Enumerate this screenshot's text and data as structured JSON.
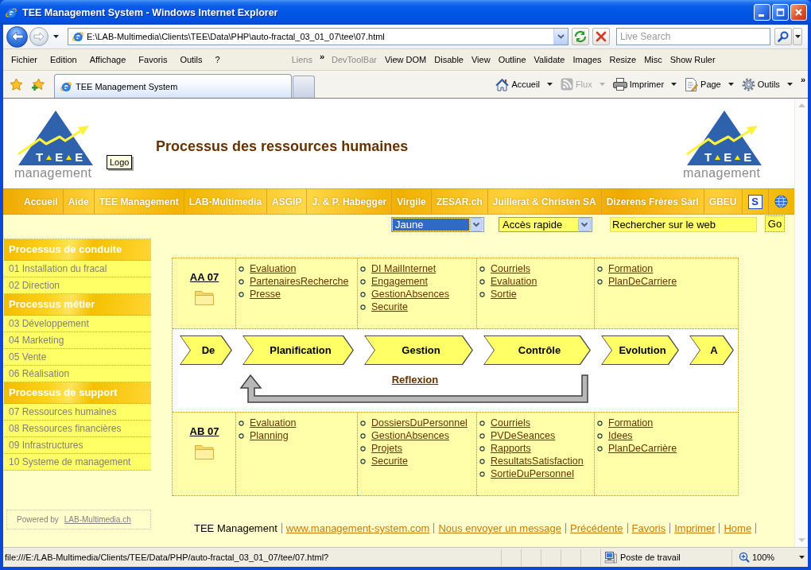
{
  "window": {
    "title": "TEE Management System - Windows Internet Explorer"
  },
  "address_bar": {
    "url": "E:\\LAB-Multimedia\\Clients\\TEE\\Data\\PHP\\auto-fractal_03_01_07\\tee\\07.html",
    "search": {
      "placeholder": "Live Search"
    }
  },
  "menu_bar": {
    "items": [
      "Fichier",
      "Edition",
      "Affichage",
      "Favoris",
      "Outils",
      "?"
    ]
  },
  "links_bar": {
    "label": "Liens",
    "more": "»"
  },
  "dev_toolbar": {
    "label": "DevToolBar",
    "items": [
      "View DOM",
      "Disable",
      "View",
      "Outline",
      "Validate",
      "Images",
      "Resize",
      "Misc",
      "Show Ruler"
    ]
  },
  "tabs": [
    {
      "label": "TEE Management System",
      "selected": true
    }
  ],
  "command_bar": {
    "items": [
      {
        "kind": "home",
        "label": "Accueil",
        "disabled": false
      },
      {
        "kind": "feeds",
        "label": "Flux",
        "disabled": true
      },
      {
        "kind": "print",
        "label": "Imprimer",
        "disabled": false
      },
      {
        "kind": "page",
        "label": "Page",
        "disabled": false
      },
      {
        "kind": "tools",
        "label": "Outils",
        "disabled": false
      }
    ],
    "more": "»"
  },
  "page": {
    "header": {
      "logos": [
        {
          "letters": [
            "T",
            "E",
            "E"
          ],
          "wordmark": "management"
        },
        {
          "letters": [
            "T",
            "E",
            "E"
          ],
          "wordmark": "management"
        }
      ],
      "title": "Processus des ressources humaines",
      "tooltip": "Logo"
    },
    "nav": {
      "links": [
        "Accueil",
        "Aide",
        "TEE Management",
        "LAB-Multimedia",
        "ASGIP",
        "J. & P. Habegger",
        "Virgile",
        "ZESAR.ch",
        "Juillerat & Christen SA",
        "Dizerens Frères Sàrl",
        "GBEU"
      ],
      "badge": "S"
    },
    "tools": {
      "color_select": {
        "value": "Jaune",
        "focused": true
      },
      "quick_select": {
        "value": "Accès rapide",
        "focused": false
      },
      "web_search": {
        "value": "Rechercher sur le web"
      },
      "go_button": "Go"
    },
    "sidebar": {
      "sections": [
        {
          "title": "Processus de conduite",
          "items": [
            "01 Installation du fracal",
            "02 Direction"
          ]
        },
        {
          "title": "Processus métier",
          "items": [
            "03 Développement",
            "04 Marketing",
            "05 Vente",
            "06 Réalisation"
          ]
        },
        {
          "title": "Processus de support",
          "items": [
            "07 Ressources humaines",
            "08 Ressources financières",
            "09 Infrastructures",
            "10 Systeme de management"
          ]
        }
      ],
      "powered_by": {
        "text": "Powered by",
        "link": "LAB-Multimedia.ch"
      }
    },
    "process_table": {
      "upper": {
        "code": "AA 07",
        "columns": [
          {
            "links": [
              "Evaluation",
              "PartenairesRecherche",
              "Presse"
            ]
          },
          {
            "links": [
              "DI MailInternet",
              "Engagement",
              "GestionAbsences",
              "Securite"
            ]
          },
          {
            "links": [
              "Courriels",
              "Evaluation",
              "Sortie"
            ]
          },
          {
            "links": [
              "Formation",
              "PlanDeCarriere"
            ]
          }
        ]
      },
      "flow": {
        "steps": [
          "De",
          "Planification",
          "Gestion",
          "Contrôle",
          "Evolution",
          "A"
        ],
        "feedback": "Reflexion"
      },
      "lower": {
        "code": "AB 07",
        "columns": [
          {
            "links": [
              "Evaluation",
              "Planning"
            ]
          },
          {
            "links": [
              "DossiersDuPersonnel",
              "GestionAbsences",
              "Projets",
              "Securite"
            ]
          },
          {
            "links": [
              "Courriels",
              "PVDeSeances",
              "Rapports",
              "ResultatsSatisfaction",
              "SortieDuPersonnel"
            ]
          },
          {
            "links": [
              "Formation",
              "Idees",
              "PlanDeCarrière"
            ]
          }
        ]
      }
    },
    "footer": {
      "label": "TEE Management",
      "links": [
        "www.management-system.com",
        "Nous envoyer un message",
        "Précédente",
        "Favoris",
        "Imprimer",
        "Home"
      ]
    }
  },
  "status_bar": {
    "text": "file:///E:/LAB-Multimedia/Clients/TEE/Data/PHP/auto-fractal_03_01_07/tee/07.html?",
    "zone": "Poste de travail",
    "zoom": "100%"
  }
}
